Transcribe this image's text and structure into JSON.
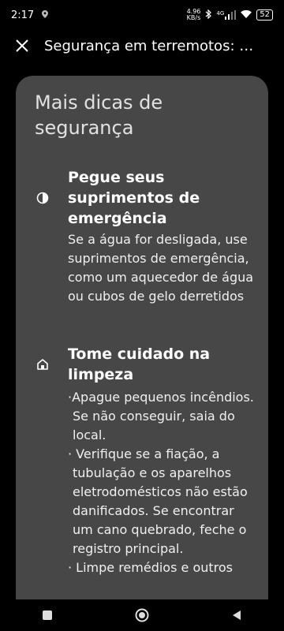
{
  "status": {
    "time": "2:17",
    "net_speed_value": "4.96",
    "net_speed_unit": "KB/s",
    "network_type": "4G",
    "battery": "52"
  },
  "appbar": {
    "title": "Segurança em terremotos: o..."
  },
  "card": {
    "title": "Mais dicas de segurança",
    "tips": [
      {
        "icon": "contrast-icon",
        "heading": "Pegue seus suprimentos de emergência",
        "body": "Se a água for desligada, use suprimentos de emergência, como um aquecedor de água ou cubos de gelo derretidos"
      },
      {
        "icon": "home-icon",
        "heading": "Tome cuidado na limpeza",
        "bullets": [
          "·Apague pequenos incêndios. Se não conseguir, saia do local.",
          "· Verifique se a fiação, a tubulação e os aparelhos eletrodomésticos não estão danificados. Se encontrar um cano quebrado, feche o registro principal.",
          "· Limpe remédios e outros"
        ]
      }
    ]
  }
}
